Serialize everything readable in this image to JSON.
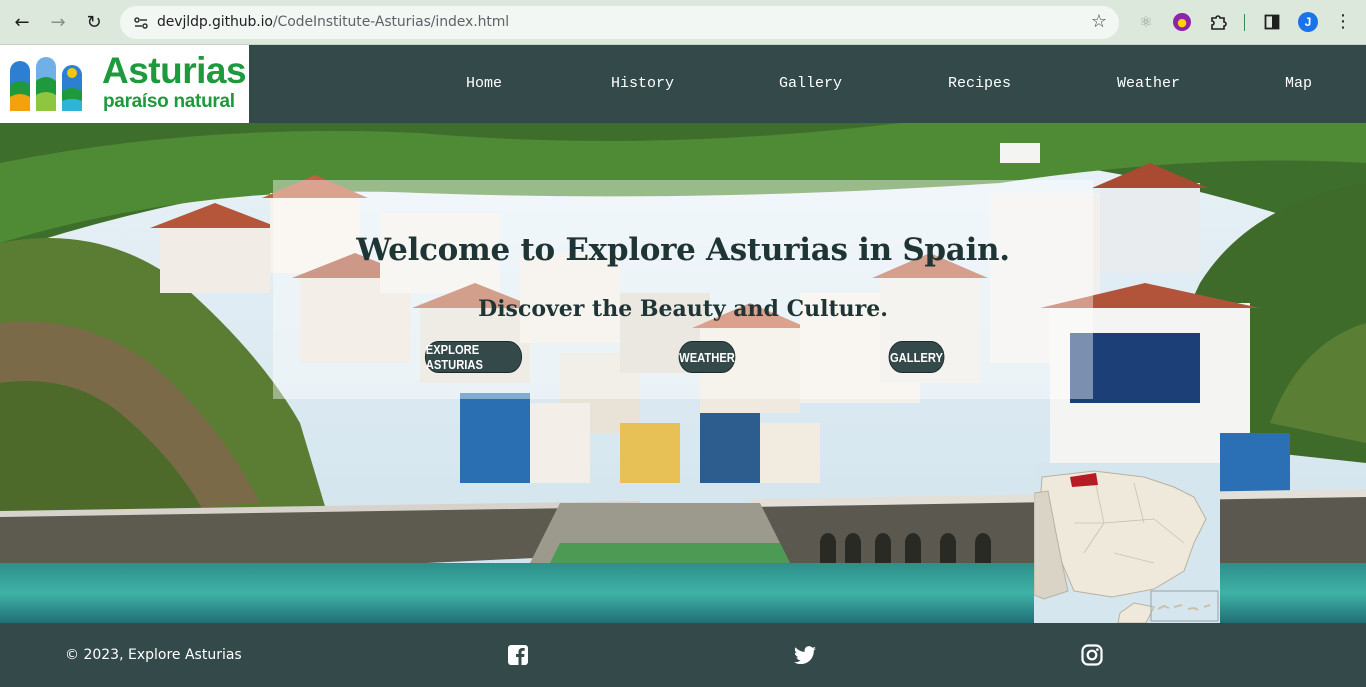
{
  "browser": {
    "url_host": "devjldp.github.io",
    "url_path": "/CodeInstitute-Asturias/index.html",
    "icons": [
      "back-arrow-icon",
      "forward-arrow-icon",
      "reload-icon",
      "site-settings-icon",
      "bookmark-star-icon",
      "react-devtools-icon",
      "purple-extension-icon",
      "extensions-puzzle-icon",
      "side-panel-icon",
      "profile-avatar",
      "more-menu-icon"
    ],
    "avatar_initial": "J",
    "accent_color": "#1a73e8"
  },
  "logo": {
    "title": "Asturias",
    "subtitle": "paraíso natural",
    "color": "#1e9a3c"
  },
  "nav": {
    "items": [
      {
        "label": "Home"
      },
      {
        "label": "History"
      },
      {
        "label": "Gallery"
      },
      {
        "label": "Recipes"
      },
      {
        "label": "Weather"
      },
      {
        "label": "Map"
      }
    ],
    "background": "#34494a"
  },
  "hero": {
    "heading": "Welcome to Explore Asturias in Spain.",
    "subheading": "Discover the Beauty and Culture.",
    "buttons": [
      {
        "label": "EXPLORE ASTURIAS"
      },
      {
        "label": "WEATHER"
      },
      {
        "label": "GALLERY"
      }
    ],
    "image": "coastal-village-photo",
    "map_image": "spain-locator-map"
  },
  "footer": {
    "copyright": "© 2023, Explore Asturias",
    "social_icons": [
      "facebook-icon",
      "twitter-icon",
      "instagram-icon"
    ]
  }
}
